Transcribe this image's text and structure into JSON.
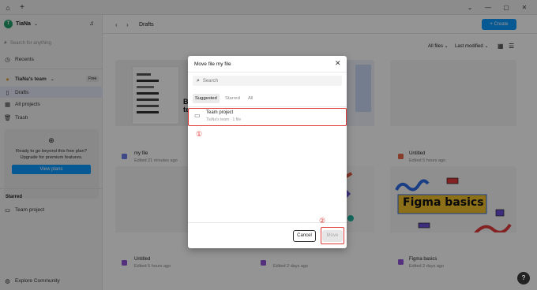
{
  "tabbar": {
    "home_icon": "home-icon",
    "new_tab": "+"
  },
  "window": {
    "minimize": "—",
    "maximize": "▢",
    "close": "✕",
    "chevron": "⌄"
  },
  "sidebar": {
    "user_name": "TiaNa",
    "user_initial": "T",
    "search_placeholder": "Search for anything",
    "recents": "Recents",
    "team_name": "TiaNa's team",
    "team_badge": "Free",
    "items": [
      {
        "label": "Drafts",
        "icon": "file-icon"
      },
      {
        "label": "All projects",
        "icon": "grid-icon"
      },
      {
        "label": "Trash",
        "icon": "trash-icon"
      }
    ],
    "promo": {
      "text": "Ready to go beyond this free plan? Upgrade for premium features.",
      "button": "View plans"
    },
    "starred_title": "Starred",
    "starred_items": [
      {
        "label": "Team project"
      }
    ],
    "explore": "Explore Community"
  },
  "main": {
    "breadcrumb": "Drafts",
    "create_button": "+ Create",
    "filter_files": "All files",
    "sort": "Last modified",
    "files": [
      {
        "name": "my file",
        "meta": "Edited 21 minutes ago",
        "color": "#6d7eea"
      },
      {
        "name": "Untitled",
        "meta": "Edited 5 hours ago",
        "color": "#e8694a"
      },
      {
        "name": "Untitled",
        "meta": "Edited 5 hours ago",
        "color": "#8f55d6"
      },
      {
        "name": "",
        "meta": "Edited 2 days ago",
        "color": "#8f55d6"
      },
      {
        "name": "Figma basics",
        "meta": "Edited 2 days ago",
        "color": "#8f55d6"
      }
    ],
    "figma_basics_title": "Figma basics"
  },
  "modal": {
    "title": "Move file my file",
    "search_placeholder": "Search",
    "tabs": [
      "Suggested",
      "Starred",
      "All"
    ],
    "project_name": "Team project",
    "project_meta": "TiaNa's team · 1 file",
    "cancel": "Cancel",
    "move": "Move"
  },
  "annotations": {
    "one": "①",
    "two": "②"
  },
  "help": "?"
}
